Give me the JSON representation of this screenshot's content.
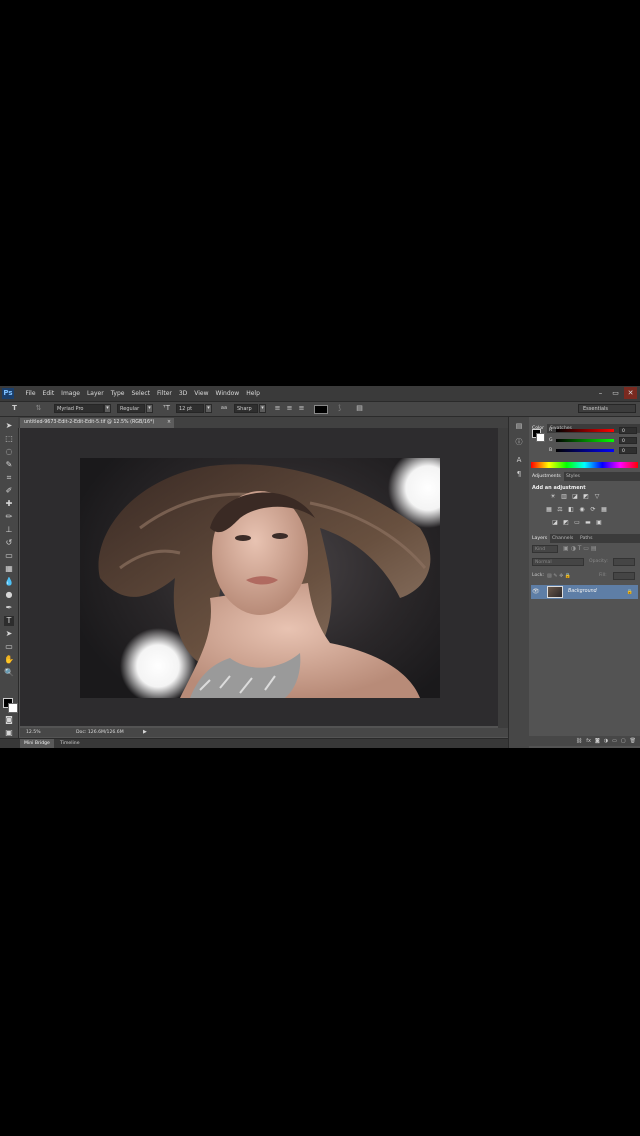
{
  "app": {
    "logo": "Ps",
    "menu": [
      "File",
      "Edit",
      "Image",
      "Layer",
      "Type",
      "Select",
      "Filter",
      "3D",
      "View",
      "Window",
      "Help"
    ],
    "window_buttons": [
      "–",
      "▭",
      "✕"
    ]
  },
  "options_bar": {
    "tool_icon": "T",
    "font_family": "Myriad Pro",
    "font_style": "Regular",
    "font_size": "12 pt",
    "aa_label": "aa",
    "antialias": "Sharp",
    "workspace": "Essentials"
  },
  "document": {
    "tab_title": "untitled-9673-Edit-2-Edit-Edit-5.tif @ 12.5% (RGB/16*)",
    "close": "×"
  },
  "status": {
    "zoom": "12.5%",
    "doc_size": "Doc: 126.6M/126.6M",
    "play": "▶"
  },
  "bottom_tabs": [
    "Mini Bridge",
    "Timeline"
  ],
  "color_panel": {
    "tabs": [
      "Color",
      "Swatches"
    ],
    "channels": [
      {
        "label": "R",
        "value": "0"
      },
      {
        "label": "G",
        "value": "0"
      },
      {
        "label": "B",
        "value": "0"
      }
    ]
  },
  "adjustments_panel": {
    "tabs": [
      "Adjustments",
      "Styles"
    ],
    "title": "Add an adjustment"
  },
  "layers_panel": {
    "tabs": [
      "Layers",
      "Channels",
      "Paths"
    ],
    "kind_label": "Kind",
    "blend_mode": "Normal",
    "opacity_label": "Opacity:",
    "lock_label": "Lock:",
    "fill_label": "Fill:",
    "layer_name": "Background"
  },
  "colors": {
    "panel_bg": "#535353",
    "selected_layer": "#5e7ea6"
  }
}
